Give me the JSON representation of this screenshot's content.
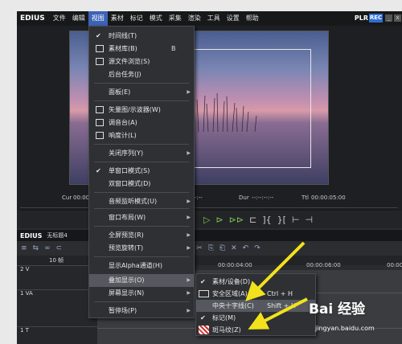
{
  "app": {
    "logo": "EDIUS",
    "plr": "PLR",
    "rec": "REC"
  },
  "menubar": [
    "文件",
    "编辑",
    "视图",
    "素材",
    "标记",
    "模式",
    "采集",
    "渲染",
    "工具",
    "设置",
    "帮助"
  ],
  "preview": {
    "cur_label": "Cur",
    "cur_value": "00:00",
    "dash1": "-:--:--:--",
    "dur_label": "Dur",
    "dur_value": "--:--:--:--",
    "ttl_label": "Ttl",
    "ttl_value": "00:00:05:00"
  },
  "timeline": {
    "logo": "EDIUS",
    "sequence": "无标题4",
    "zoom": "10 帧",
    "ruler": [
      "00:00:04:00",
      "00:00:06:00",
      "00:00:08:00"
    ],
    "tracks": [
      {
        "name": "2 V",
        "mark": "日"
      },
      {
        "name": "1 VA",
        "mark": "日"
      },
      {
        "name": "1 T",
        "mark": ""
      }
    ]
  },
  "view_menu": {
    "items": [
      {
        "label": "时间线(T)",
        "check": true
      },
      {
        "label": "素材库(B)",
        "icon": "bin-icon",
        "shortcut": "B"
      },
      {
        "label": "源文件浏览(S)",
        "icon": "browser-icon"
      },
      {
        "label": "后台任务(J)"
      },
      {
        "label": "面板(E)",
        "submenu": true
      },
      {
        "label": "矢量图/示波器(W)",
        "icon": "scope-icon"
      },
      {
        "label": "调音台(A)",
        "icon": "mixer-icon"
      },
      {
        "label": "响度计(L)",
        "icon": "loudness-icon"
      },
      {
        "label": "关闭序列(Y)",
        "submenu": true
      },
      {
        "label": "单窗口模式(S)",
        "check": true
      },
      {
        "label": "双窗口模式(D)"
      },
      {
        "label": "音频监听模式(U)",
        "submenu": true
      },
      {
        "label": "窗口布局(W)",
        "submenu": true
      },
      {
        "label": "全屏预览(R)",
        "submenu": true
      },
      {
        "label": "预览旋转(T)",
        "submenu": true
      },
      {
        "label": "显示Alpha通道(H)"
      },
      {
        "label": "叠加显示(O)",
        "submenu": true,
        "highlight": true
      },
      {
        "label": "屏幕显示(N)",
        "submenu": true
      },
      {
        "label": "暂停场(P)",
        "submenu": true
      }
    ]
  },
  "overlay_submenu": {
    "items": [
      {
        "label": "素材/设备(D)",
        "check": true
      },
      {
        "label": "安全区域(A)",
        "shortcut": "Ctrl + H",
        "icon": "safe-area-icon"
      },
      {
        "label": "中央十字线(C)",
        "shortcut": "Shift + H",
        "highlight": true
      },
      {
        "label": "标记(M)",
        "check": true
      },
      {
        "label": "斑马纹(Z)",
        "icon": "zebra-icon"
      }
    ]
  },
  "watermark": {
    "brand": "Bai 经验",
    "url": "jingyan.baidu.com"
  },
  "colors": {
    "highlight": "#55595f",
    "accent": "#3d62b6",
    "arrow": "#f2e21c",
    "play": "#7ec64a"
  }
}
